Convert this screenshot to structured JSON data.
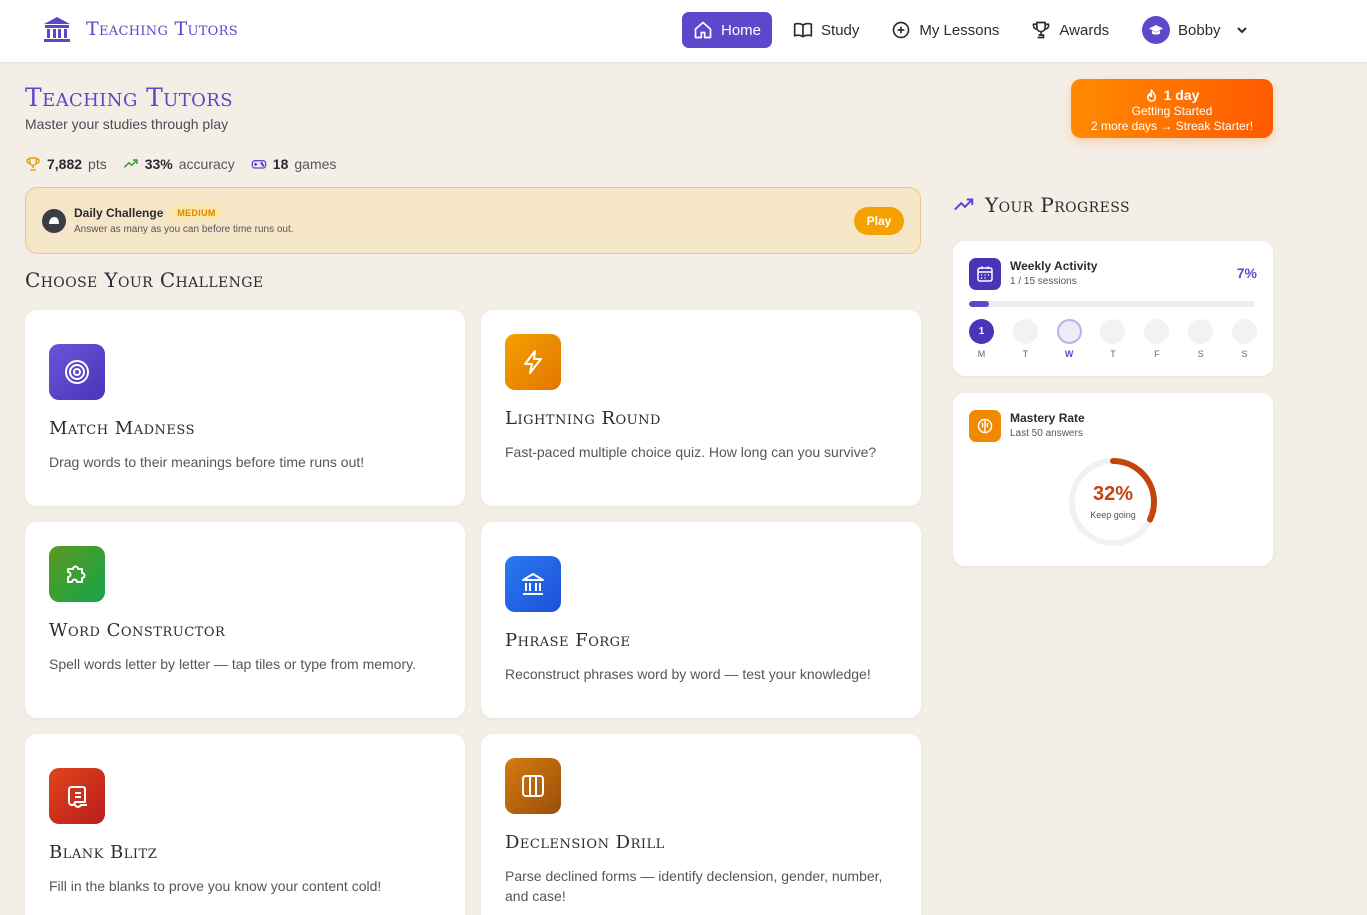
{
  "nav": {
    "brand": "Teaching Tutors",
    "items": [
      {
        "label": "Home",
        "icon": "home-icon",
        "active": true
      },
      {
        "label": "Study",
        "icon": "book-icon"
      },
      {
        "label": "My Lessons",
        "icon": "plus-circle-icon"
      },
      {
        "label": "Awards",
        "icon": "trophy-icon"
      }
    ],
    "user": "Bobby"
  },
  "header": {
    "title": "Teaching Tutors",
    "subtitle": "Master your studies through play",
    "stats": {
      "points_value": "7,882",
      "points_unit": "pts",
      "accuracy_value": "33%",
      "accuracy_unit": "accuracy",
      "games_value": "18",
      "games_unit": "games"
    }
  },
  "streak": {
    "days": "1 day",
    "level": "Getting Started",
    "next": "2 more days → Streak Starter!"
  },
  "daily": {
    "title": "Daily Challenge",
    "badge": "MEDIUM",
    "desc": "Answer as many as you can before time runs out.",
    "play": "Play"
  },
  "section_title": "Choose Your Challenge",
  "games": [
    {
      "title": "Match Madness",
      "desc": "Drag words to their meanings before time runs out!",
      "icon": "target-icon",
      "color": "#5b45c9"
    },
    {
      "title": "Lightning Round",
      "desc": "Fast-paced multiple choice quiz. How long can you survive?",
      "icon": "lightning-icon",
      "color": "#ef8a00"
    },
    {
      "title": "Word Constructor",
      "desc": "Spell words letter by letter — tap tiles or type from memory.",
      "icon": "puzzle-icon",
      "color": "#3f9a2c"
    },
    {
      "title": "Phrase Forge",
      "desc": "Reconstruct phrases word by word — test your knowledge!",
      "icon": "temple-icon",
      "color": "#2563eb"
    },
    {
      "title": "Blank Blitz",
      "desc": "Fill in the blanks to prove you know your content cold!",
      "icon": "scroll-icon",
      "color": "#d02a10"
    },
    {
      "title": "Declension Drill",
      "desc": "Parse declined forms — identify declension, gender, number, and case!",
      "icon": "columns-icon",
      "color": "#c86a08"
    }
  ],
  "progress": {
    "title": "Your Progress",
    "weekly": {
      "title": "Weekly Activity",
      "sub": "1 / 15 sessions",
      "pct_label": "7%",
      "pct": 0.07,
      "days": [
        {
          "label": "M",
          "value": "1",
          "state": "done"
        },
        {
          "label": "T",
          "value": "",
          "state": "empty"
        },
        {
          "label": "W",
          "value": "",
          "state": "today"
        },
        {
          "label": "T",
          "value": "",
          "state": "empty"
        },
        {
          "label": "F",
          "value": "",
          "state": "empty"
        },
        {
          "label": "S",
          "value": "",
          "state": "empty"
        },
        {
          "label": "S",
          "value": "",
          "state": "empty"
        }
      ]
    },
    "mastery": {
      "title": "Mastery Rate",
      "sub": "Last 50 answers",
      "value_label": "32%",
      "value": 0.32,
      "status": "Keep going"
    }
  },
  "colors": {
    "brand": "#5a48c8",
    "accent_orange": "#ff7a00",
    "ring": "#c4440e"
  }
}
